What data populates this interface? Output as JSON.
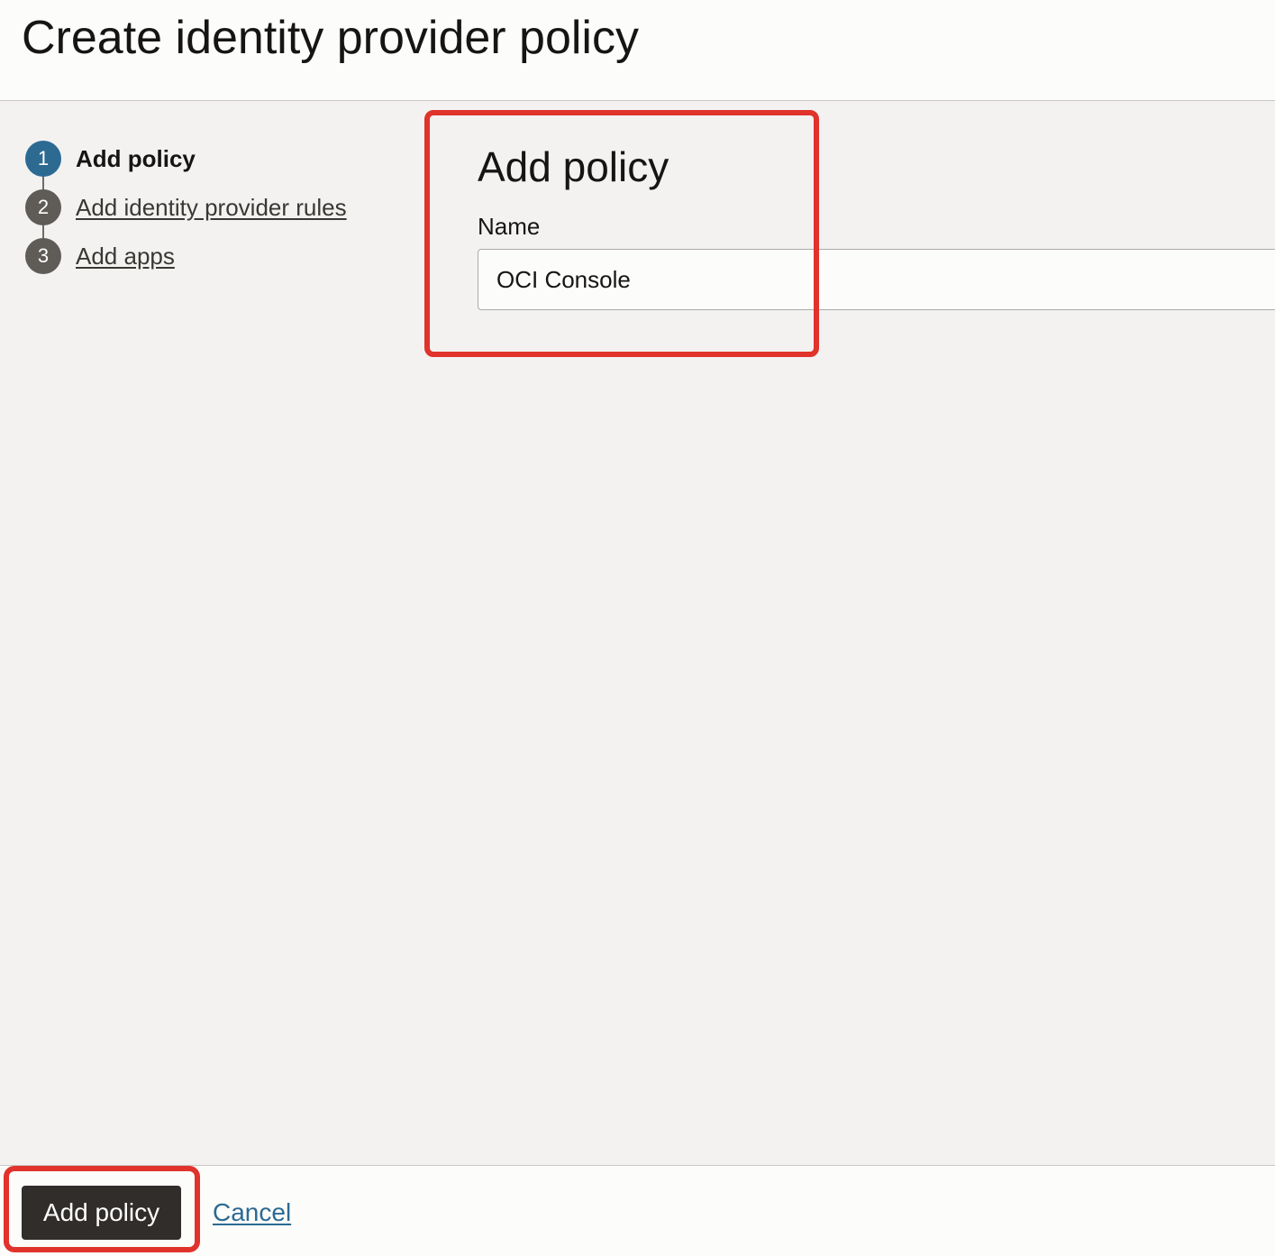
{
  "header": {
    "title": "Create identity provider policy"
  },
  "steps": [
    {
      "number": "1",
      "label": "Add policy",
      "active": true
    },
    {
      "number": "2",
      "label": "Add identity provider rules",
      "active": false
    },
    {
      "number": "3",
      "label": "Add apps",
      "active": false
    }
  ],
  "form": {
    "section_title": "Add policy",
    "name_label": "Name",
    "name_value": "OCI Console"
  },
  "footer": {
    "primary_label": "Add policy",
    "cancel_label": "Cancel"
  },
  "colors": {
    "active_step": "#2c6a92",
    "inactive_step": "#5f5c57",
    "primary_button": "#312d2a",
    "link": "#2c6a92",
    "annotation_highlight": "#e0332b"
  }
}
